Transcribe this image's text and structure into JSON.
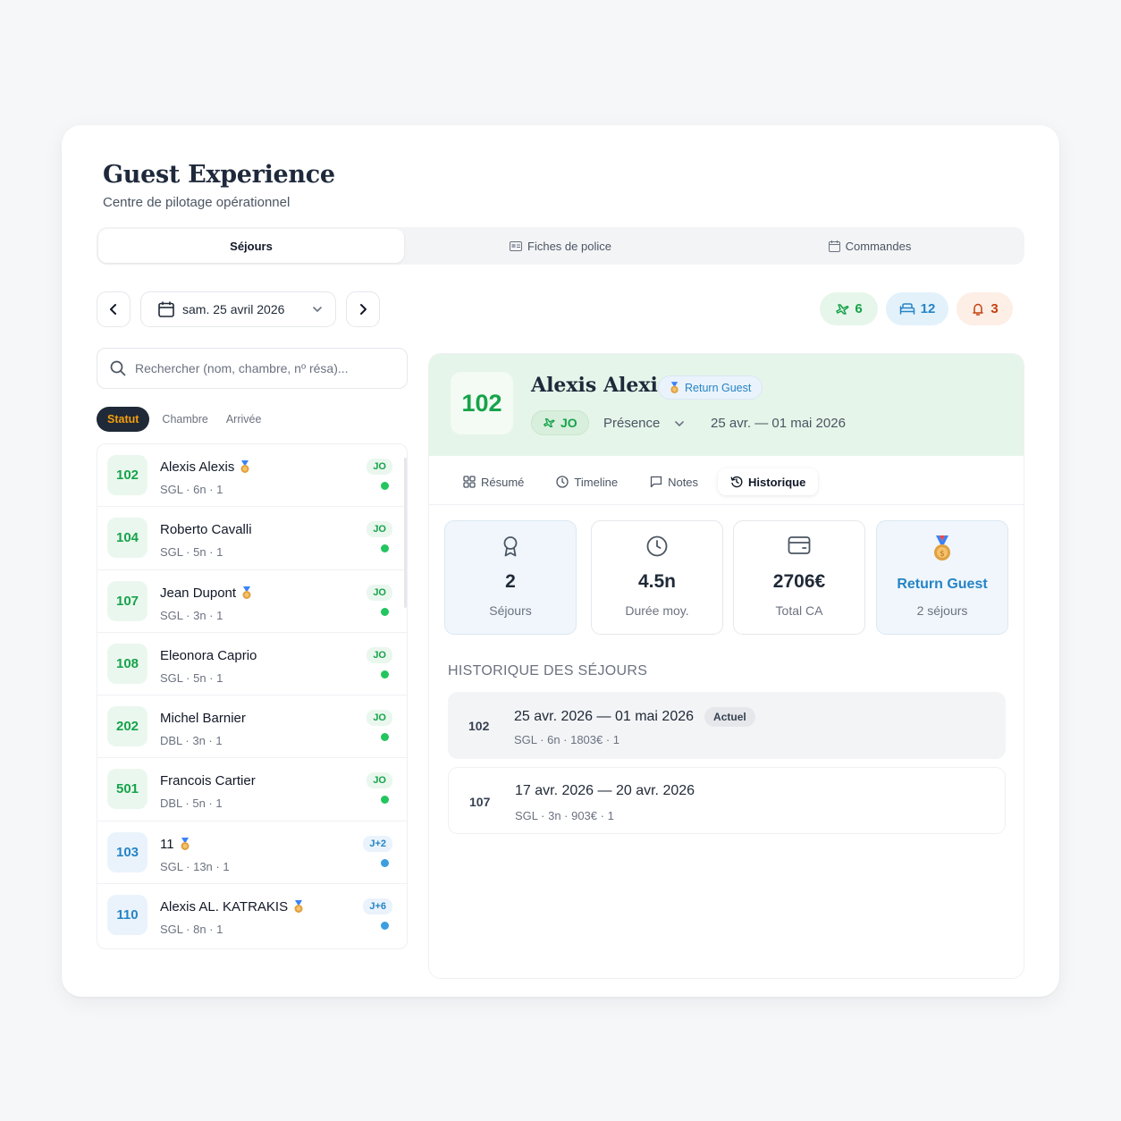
{
  "header": {
    "title": "Guest Experience",
    "subtitle": "Centre de pilotage opérationnel"
  },
  "tabs": [
    {
      "label": "Séjours",
      "icon": "",
      "active": true
    },
    {
      "label": "Fiches de police",
      "icon": "id-card-icon",
      "active": false
    },
    {
      "label": "Commandes",
      "icon": "calendar-icon",
      "active": false
    }
  ],
  "date_nav": {
    "date_label": "sam. 25 avril 2026"
  },
  "counters": [
    {
      "icon": "plane-icon",
      "value": "6",
      "color": "#16a34a",
      "bg": "#e7f6ea"
    },
    {
      "icon": "bed-icon",
      "value": "12",
      "color": "#2584c6",
      "bg": "#e3f1fb"
    },
    {
      "icon": "bell-icon",
      "value": "3",
      "color": "#c2410c",
      "bg": "#fdeee6"
    }
  ],
  "search": {
    "placeholder": "Rechercher (nom, chambre, nº résa)..."
  },
  "sort": {
    "options": [
      "Statut",
      "Chambre",
      "Arrivée"
    ],
    "active": "Statut"
  },
  "guests": [
    {
      "room": "102",
      "name": "Alexis Alexis",
      "medal": true,
      "meta": "SGL · 6n · 1",
      "badge": "JO",
      "status": "green"
    },
    {
      "room": "104",
      "name": "Roberto Cavalli",
      "medal": false,
      "meta": "SGL · 5n · 1",
      "badge": "JO",
      "status": "green"
    },
    {
      "room": "107",
      "name": "Jean Dupont",
      "medal": true,
      "meta": "SGL · 3n · 1",
      "badge": "JO",
      "status": "green"
    },
    {
      "room": "108",
      "name": "Eleonora Caprio",
      "medal": false,
      "meta": "SGL · 5n · 1",
      "badge": "JO",
      "status": "green"
    },
    {
      "room": "202",
      "name": "Michel Barnier",
      "medal": false,
      "meta": "DBL · 3n · 1",
      "badge": "JO",
      "status": "green"
    },
    {
      "room": "501",
      "name": "Francois Cartier",
      "medal": false,
      "meta": "DBL · 5n · 1",
      "badge": "JO",
      "status": "green"
    },
    {
      "room": "103",
      "name": "11",
      "medal": true,
      "meta": "SGL · 13n · 1",
      "badge": "J+2",
      "status": "blue"
    },
    {
      "room": "110",
      "name": "Alexis AL. KATRAKIS",
      "medal": true,
      "meta": "SGL · 8n · 1",
      "badge": "J+6",
      "status": "blue"
    }
  ],
  "detail": {
    "room": "102",
    "name": "Alexis Alexis",
    "tag": "Return Guest",
    "status_tag": "JO",
    "presence": "Présence",
    "dates": "25 avr. — 01 mai 2026",
    "tabs": [
      {
        "label": "Résumé",
        "icon": "grid-icon",
        "active": false
      },
      {
        "label": "Timeline",
        "icon": "clock-icon",
        "active": false
      },
      {
        "label": "Notes",
        "icon": "message-icon",
        "active": false
      },
      {
        "label": "Historique",
        "icon": "history-icon",
        "active": true
      }
    ],
    "stats": [
      {
        "icon": "award-icon",
        "value": "2",
        "label": "Séjours"
      },
      {
        "icon": "clock-icon",
        "value": "4.5n",
        "label": "Durée moy."
      },
      {
        "icon": "wallet-icon",
        "value": "2706€",
        "label": "Total CA"
      },
      {
        "icon": "medal-icon",
        "value": "Return Guest",
        "label": "2 séjours"
      }
    ],
    "history_title": "HISTORIQUE DES SÉJOURS",
    "history": [
      {
        "room": "102",
        "dates": "25 avr. 2026 — 01 mai 2026",
        "badge": "Actuel",
        "meta": "SGL · 6n · 1803€ · 1"
      },
      {
        "room": "107",
        "dates": "17 avr. 2026 — 20 avr. 2026",
        "badge": "",
        "meta": "SGL · 3n · 903€ · 1"
      }
    ]
  }
}
